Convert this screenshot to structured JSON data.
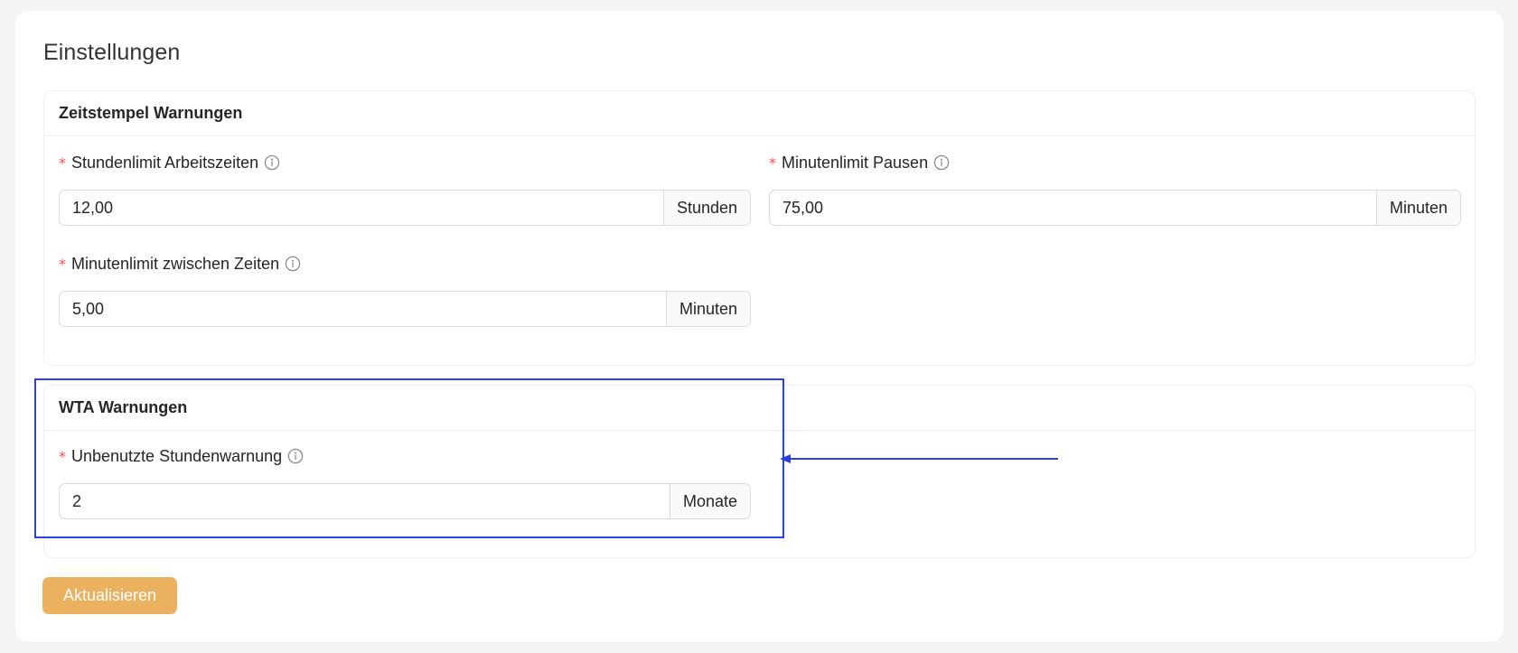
{
  "page": {
    "title": "Einstellungen"
  },
  "sections": [
    {
      "title": "Zeitstempel Warnungen",
      "fields": [
        {
          "label": "Stundenlimit Arbeitszeiten",
          "required_mark": "*",
          "value": "12,00",
          "unit": "Stunden"
        },
        {
          "label": "Minutenlimit Pausen",
          "required_mark": "*",
          "value": "75,00",
          "unit": "Minuten"
        },
        {
          "label": "Minutenlimit zwischen Zeiten",
          "required_mark": "*",
          "value": "5,00",
          "unit": "Minuten"
        }
      ]
    },
    {
      "title": "WTA Warnungen",
      "fields": [
        {
          "label": "Unbenutzte Stundenwarnung",
          "required_mark": "*",
          "value": "2",
          "unit": "Monate"
        }
      ]
    }
  ],
  "actions": {
    "submit_label": "Aktualisieren"
  },
  "icons": {
    "info": "info-circle-icon"
  },
  "colors": {
    "accent": "#ebb15f",
    "required": "#ff4d4f",
    "annotation": "#2b3fe0"
  }
}
